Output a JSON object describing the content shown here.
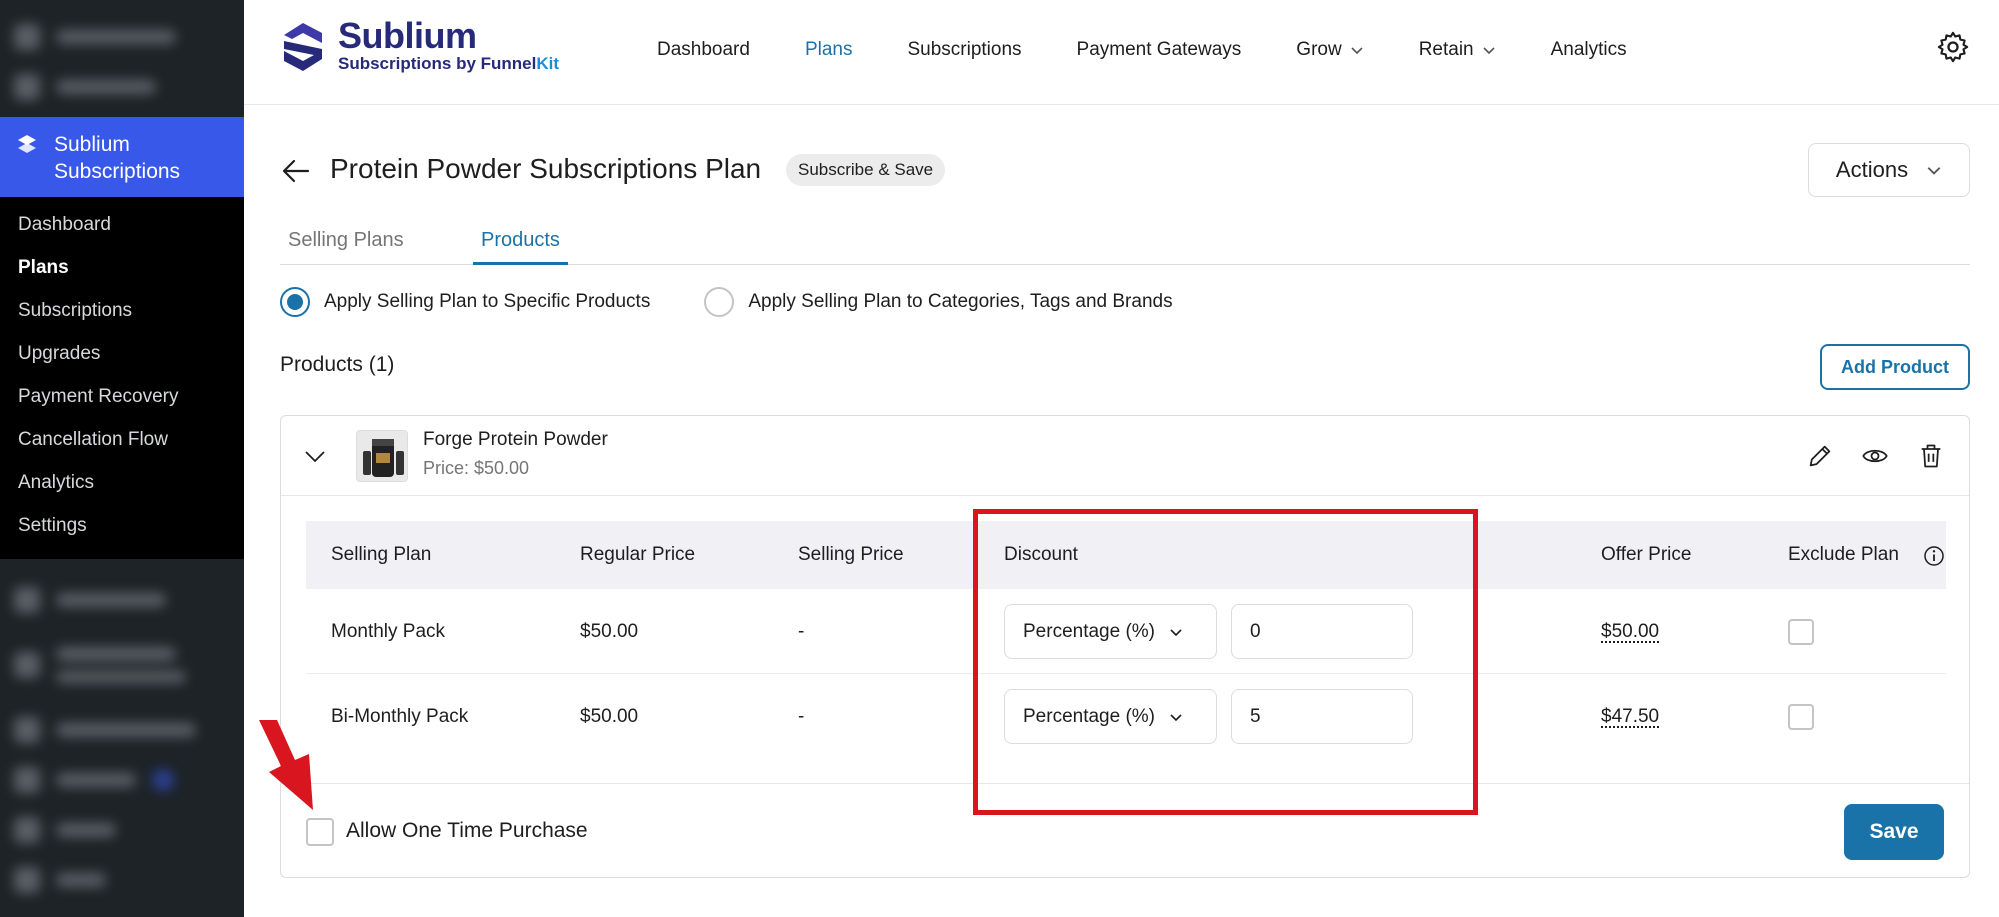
{
  "sidebar": {
    "active_label": "Sublium Subscriptions",
    "items": [
      {
        "label": "Dashboard"
      },
      {
        "label": "Plans"
      },
      {
        "label": "Subscriptions"
      },
      {
        "label": "Upgrades"
      },
      {
        "label": "Payment Recovery"
      },
      {
        "label": "Cancellation Flow"
      },
      {
        "label": "Analytics"
      },
      {
        "label": "Settings"
      }
    ]
  },
  "brand": {
    "name": "Sublium",
    "tagline_prefix": "Subscriptions by Funnel",
    "tagline_suffix": "Kit",
    "color": "#272a79",
    "accent": "#1a8fd8"
  },
  "topnav": {
    "items": [
      {
        "label": "Dashboard"
      },
      {
        "label": "Plans"
      },
      {
        "label": "Subscriptions"
      },
      {
        "label": "Payment Gateways"
      },
      {
        "label": "Grow"
      },
      {
        "label": "Retain"
      },
      {
        "label": "Analytics"
      }
    ]
  },
  "page": {
    "title": "Protein Powder Subscriptions Plan",
    "badge": "Subscribe & Save",
    "actions_label": "Actions"
  },
  "tabs": [
    {
      "label": "Selling Plans"
    },
    {
      "label": "Products"
    }
  ],
  "apply_options": [
    {
      "label": "Apply Selling Plan to Specific Products",
      "selected": true
    },
    {
      "label": "Apply Selling Plan to Categories, Tags and Brands",
      "selected": false
    }
  ],
  "products": {
    "heading": "Products (1)",
    "add_button": "Add Product",
    "item": {
      "name": "Forge Protein Powder",
      "price": "Price: $50.00"
    },
    "table": {
      "headers": [
        "Selling Plan",
        "Regular Price",
        "Selling Price",
        "Discount",
        "Offer Price",
        "Exclude Plan"
      ],
      "rows": [
        {
          "plan": "Monthly Pack",
          "regular": "$50.00",
          "selling": "-",
          "discount_type": "Percentage (%)",
          "discount_value": "0",
          "offer": "$50.00",
          "excluded": false
        },
        {
          "plan": "Bi-Monthly Pack",
          "regular": "$50.00",
          "selling": "-",
          "discount_type": "Percentage (%)",
          "discount_value": "5",
          "offer": "$47.50",
          "excluded": false
        }
      ]
    },
    "one_time_label": "Allow One Time Purchase",
    "save_label": "Save"
  },
  "colors": {
    "primary": "#1a73a8",
    "sidebar_active": "#3858e9",
    "annotation": "#d9161f"
  }
}
